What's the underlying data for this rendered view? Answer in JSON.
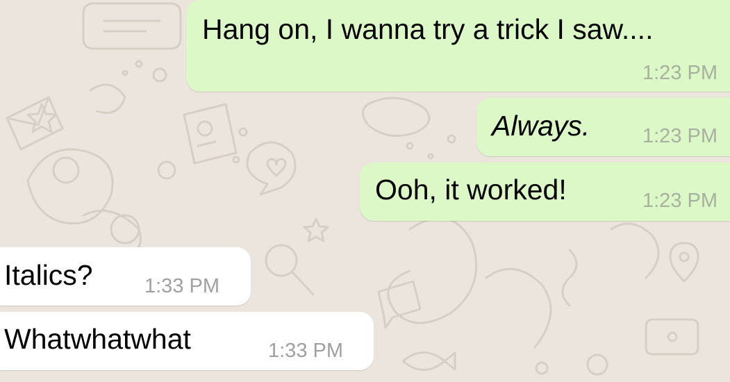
{
  "colors": {
    "background": "#ece5dd",
    "outgoing_bubble": "#dcf8c6",
    "incoming_bubble": "#ffffff",
    "text": "#000000",
    "timestamp": "#a0a0a0",
    "doodle_stroke": "#d6cfc5"
  },
  "messages": [
    {
      "direction": "outgoing",
      "text": "Hang on, I wanna try a trick I saw....",
      "time": "1:23 PM",
      "italic": false
    },
    {
      "direction": "outgoing",
      "text": "Always.",
      "time": "1:23 PM",
      "italic": true
    },
    {
      "direction": "outgoing",
      "text": "Ooh, it worked!",
      "time": "1:23 PM",
      "italic": false
    },
    {
      "direction": "incoming",
      "text": "Italics?",
      "time": "1:33 PM",
      "italic": false
    },
    {
      "direction": "incoming",
      "text": "Whatwhatwhat",
      "time": "1:33 PM",
      "italic": false
    }
  ]
}
